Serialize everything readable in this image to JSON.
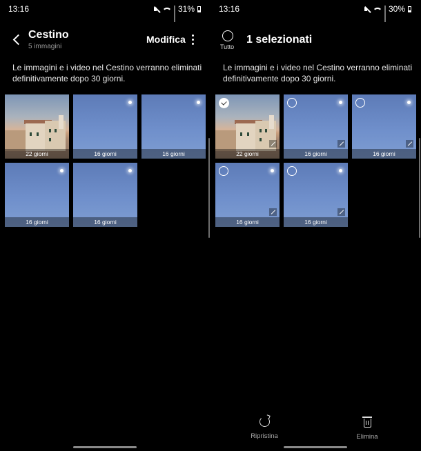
{
  "left": {
    "status": {
      "time": "13:16",
      "battery": "31%"
    },
    "header": {
      "title": "Cestino",
      "subtitle": "5 immagini",
      "edit_label": "Modifica"
    },
    "notice": "Le immagini e i video nel Cestino verranno eliminati definitivamente dopo 30 giorni.",
    "items": [
      {
        "days": "22 giorni",
        "kind": "town"
      },
      {
        "days": "16 giorni",
        "kind": "sky"
      },
      {
        "days": "16 giorni",
        "kind": "sky"
      },
      {
        "days": "16 giorni",
        "kind": "sky"
      },
      {
        "days": "16 giorni",
        "kind": "sky"
      }
    ]
  },
  "right": {
    "status": {
      "time": "13:16",
      "battery": "30%"
    },
    "header": {
      "select_all_label": "Tutto",
      "title": "1 selezionati"
    },
    "notice": "Le immagini e i video nel Cestino verranno eliminati definitivamente dopo 30 giorni.",
    "items": [
      {
        "days": "22 giorni",
        "kind": "town",
        "selected": true
      },
      {
        "days": "16 giorni",
        "kind": "sky",
        "selected": false
      },
      {
        "days": "16 giorni",
        "kind": "sky",
        "selected": false
      },
      {
        "days": "16 giorni",
        "kind": "sky",
        "selected": false
      },
      {
        "days": "16 giorni",
        "kind": "sky",
        "selected": false
      }
    ],
    "actions": {
      "restore_label": "Ripristina",
      "delete_label": "Elimina"
    }
  }
}
